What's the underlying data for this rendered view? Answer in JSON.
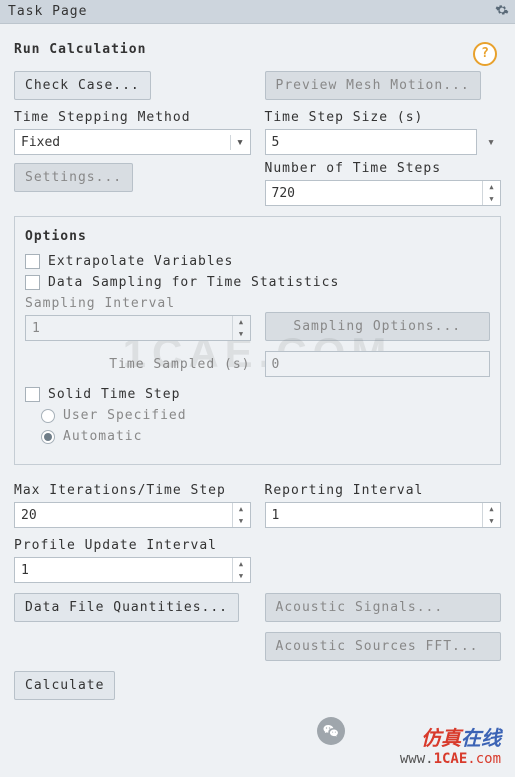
{
  "header": {
    "title": "Task Page"
  },
  "section_title": "Run Calculation",
  "buttons": {
    "check_case": "Check Case...",
    "preview_mesh": "Preview Mesh Motion...",
    "settings": "Settings...",
    "sampling_options": "Sampling Options...",
    "data_file_quantities": "Data File Quantities...",
    "acoustic_signals": "Acoustic Signals...",
    "acoustic_sources_fft": "Acoustic Sources FFT...",
    "calculate": "Calculate"
  },
  "labels": {
    "time_stepping_method": "Time Stepping Method",
    "time_step_size": "Time Step Size (s)",
    "number_time_steps": "Number of Time Steps",
    "sampling_interval": "Sampling Interval",
    "time_sampled": "Time Sampled (s)",
    "max_iter": "Max Iterations/Time Step",
    "reporting_interval": "Reporting Interval",
    "profile_update_interval": "Profile Update Interval"
  },
  "fields": {
    "time_stepping_method": "Fixed",
    "time_step_size": "5",
    "number_time_steps": "720",
    "sampling_interval": "1",
    "time_sampled": "0",
    "max_iter": "20",
    "reporting_interval": "1",
    "profile_update_interval": "1"
  },
  "options": {
    "title": "Options",
    "extrapolate": "Extrapolate Variables",
    "data_sampling": "Data Sampling for Time Statistics",
    "solid_time_step": "Solid Time Step",
    "user_specified": "User Specified",
    "automatic": "Automatic"
  },
  "watermark": "1CAE.COM",
  "brand": {
    "ch_a": "仿真",
    "ch_b": "在线",
    "url_pre": "www.",
    "url_mid": "1CAE",
    "url_suf": ".com"
  }
}
